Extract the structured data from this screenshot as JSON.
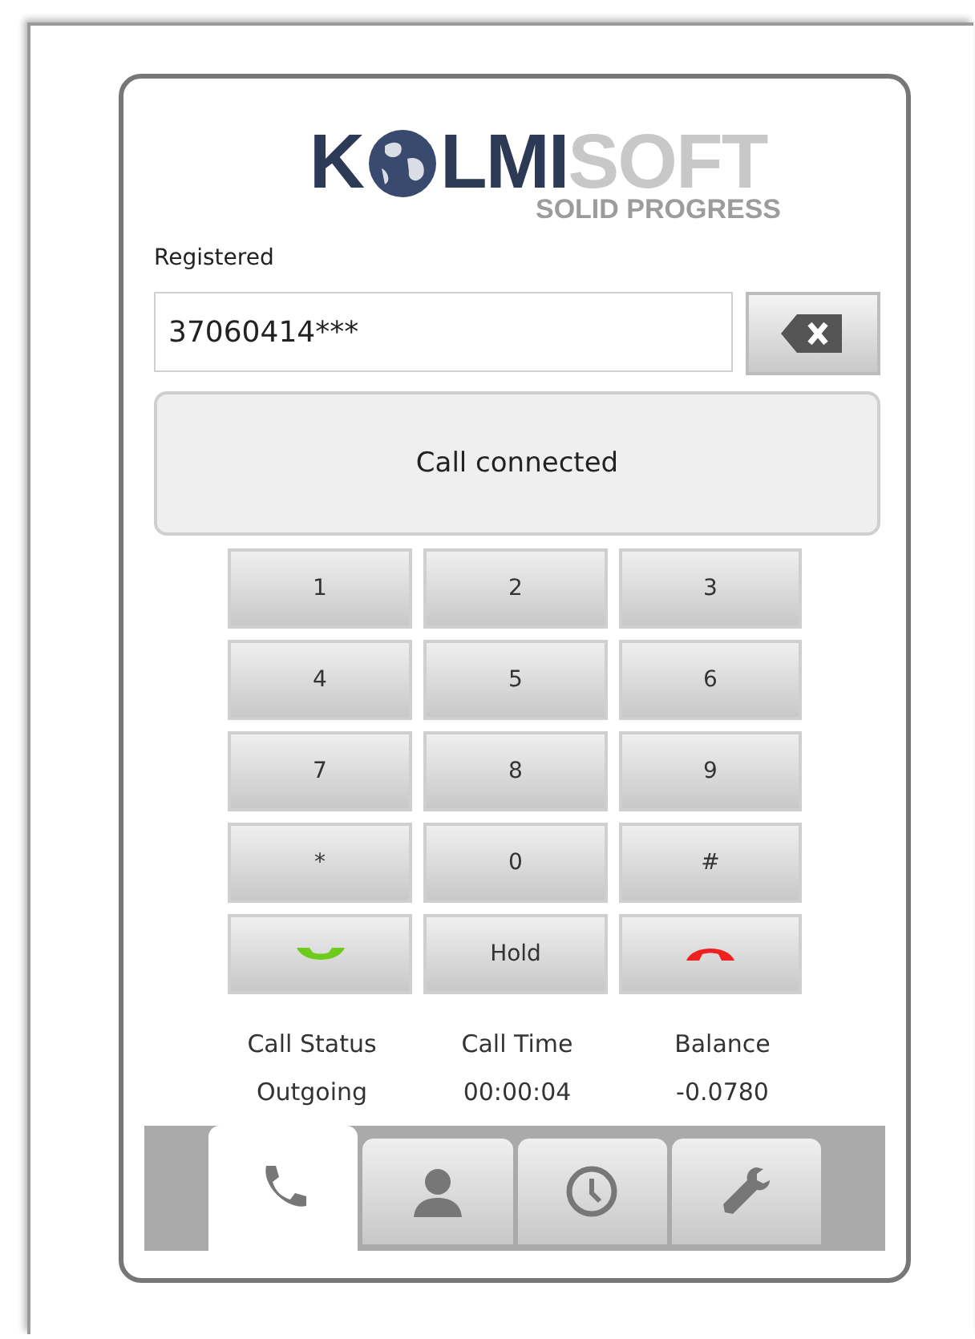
{
  "logo": {
    "lead": "K",
    "middle": "LMI",
    "tail": "SOFT",
    "tagline": "SOLID PROGRESS"
  },
  "registration": "Registered",
  "number_field": {
    "value": "37060414***"
  },
  "status_message": "Call connected",
  "keypad": [
    {
      "kind": "digit",
      "label": "1"
    },
    {
      "kind": "digit",
      "label": "2"
    },
    {
      "kind": "digit",
      "label": "3"
    },
    {
      "kind": "digit",
      "label": "4"
    },
    {
      "kind": "digit",
      "label": "5"
    },
    {
      "kind": "digit",
      "label": "6"
    },
    {
      "kind": "digit",
      "label": "7"
    },
    {
      "kind": "digit",
      "label": "8"
    },
    {
      "kind": "digit",
      "label": "9"
    },
    {
      "kind": "digit",
      "label": "*"
    },
    {
      "kind": "digit",
      "label": "0"
    },
    {
      "kind": "digit",
      "label": "#"
    },
    {
      "kind": "call"
    },
    {
      "kind": "digit",
      "label": "Hold"
    },
    {
      "kind": "hangup"
    }
  ],
  "stats": [
    {
      "label": "Call Status",
      "value": "Outgoing"
    },
    {
      "label": "Call Time",
      "value": "00:00:04"
    },
    {
      "label": "Balance",
      "value": "-0.0780"
    }
  ],
  "tabs": [
    {
      "kind": "phone",
      "selected": true
    },
    {
      "kind": "contact",
      "selected": false
    },
    {
      "kind": "history",
      "selected": false
    },
    {
      "kind": "settings",
      "selected": false
    }
  ]
}
